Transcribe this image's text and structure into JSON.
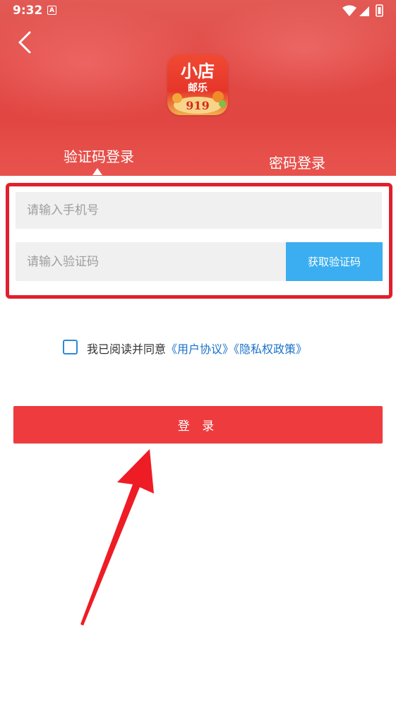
{
  "status_bar": {
    "time": "9:32",
    "notification_badge": "A"
  },
  "app": {
    "logo_text_line1": "小店",
    "logo_text_line2": "邮乐",
    "logo_number": "919"
  },
  "tabs": [
    {
      "label": "验证码登录",
      "active": true
    },
    {
      "label": "密码登录",
      "active": false
    }
  ],
  "form": {
    "phone_placeholder": "请输入手机号",
    "code_placeholder": "请输入验证码",
    "get_code_label": "获取验证码"
  },
  "agreement": {
    "prefix": "我已阅读并同意",
    "user_agreement": "《用户协议》",
    "privacy_policy": "《隐私权政策》"
  },
  "login_label": "登 录",
  "colors": {
    "header_red": "#e24a46",
    "button_red": "#ee3b3d",
    "highlight_red": "#e0202c",
    "code_button_blue": "#3aaef0",
    "link_blue": "#1a72c9"
  }
}
